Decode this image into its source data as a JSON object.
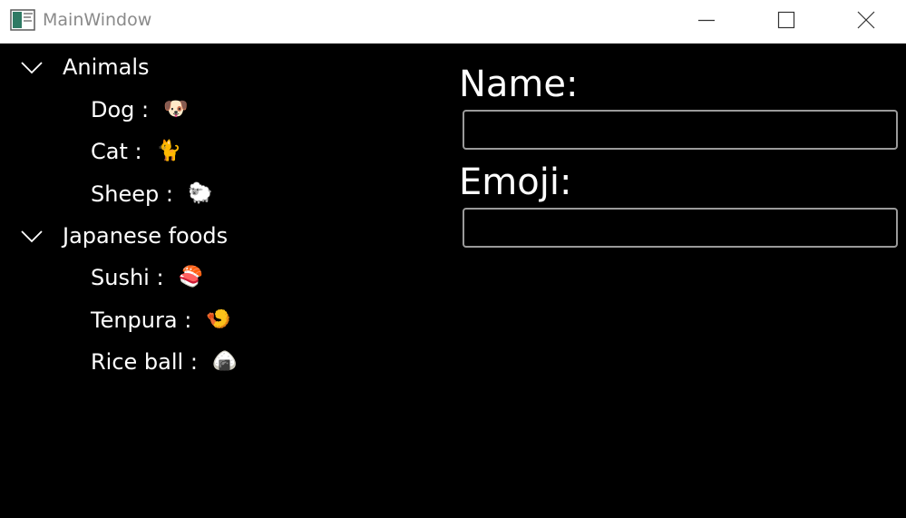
{
  "window": {
    "title": "MainWindow"
  },
  "tree": {
    "groups": [
      {
        "label": "Animals",
        "expanded": true,
        "items": [
          {
            "label": "Dog :",
            "emoji": "🐶"
          },
          {
            "label": "Cat :",
            "emoji": "🐈"
          },
          {
            "label": "Sheep :",
            "emoji": "🐑"
          }
        ]
      },
      {
        "label": "Japanese foods",
        "expanded": true,
        "items": [
          {
            "label": "Sushi :",
            "emoji": "🍣"
          },
          {
            "label": "Tenpura :",
            "emoji": "🍤"
          },
          {
            "label": "Rice ball :",
            "emoji": "🍙"
          }
        ]
      }
    ]
  },
  "form": {
    "name_label": "Name:",
    "name_value": "",
    "emoji_label": "Emoji:",
    "emoji_value": ""
  },
  "colors": {
    "background": "#000000",
    "titlebar": "#ffffff",
    "title_text": "#8a8a8a",
    "text": "#ffffff",
    "field_border": "#9a9a9a"
  }
}
